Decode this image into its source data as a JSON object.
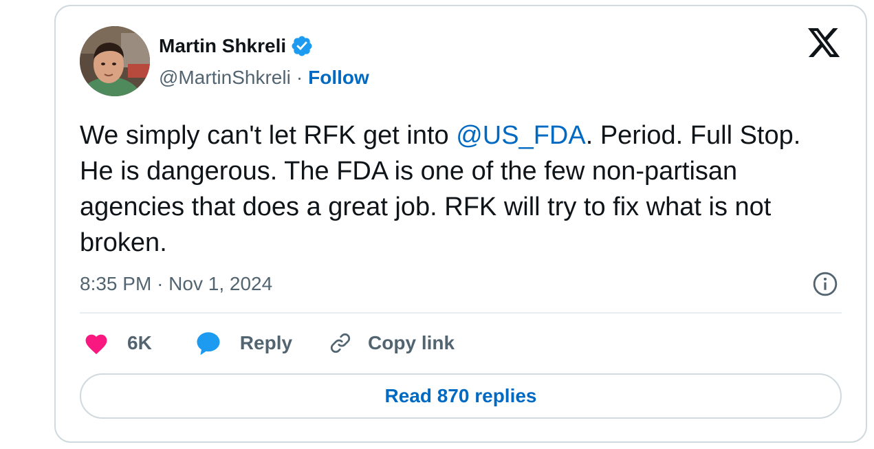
{
  "author": {
    "name": "Martin Shkreli",
    "handle": "@MartinShkreli",
    "separator": "·",
    "follow_label": "Follow",
    "verified_icon": "verified-badge-icon",
    "verified_color": "#1d9bf0"
  },
  "tweet": {
    "text_before": "We simply can't let RFK get into ",
    "mention": "@US_FDA",
    "text_after": ". Period. Full Stop. He is dangerous. The FDA is one of the few non-partisan agencies that does a great job. RFK will try to fix what is not broken.",
    "time": "8:35 PM",
    "separator": "·",
    "date": "Nov 1, 2024"
  },
  "actions": {
    "like_count": "6K",
    "like_icon": "heart-icon",
    "like_color": "#f91880",
    "reply_label": "Reply",
    "reply_icon": "speech-bubble-icon",
    "reply_color": "#1d9bf0",
    "copy_label": "Copy link",
    "copy_icon": "link-icon"
  },
  "footer": {
    "read_replies_label": "Read 870 replies"
  },
  "colors": {
    "link_blue": "#0069c2",
    "muted_gray": "#536471",
    "border": "#cfd9de",
    "text": "#0f1419"
  }
}
